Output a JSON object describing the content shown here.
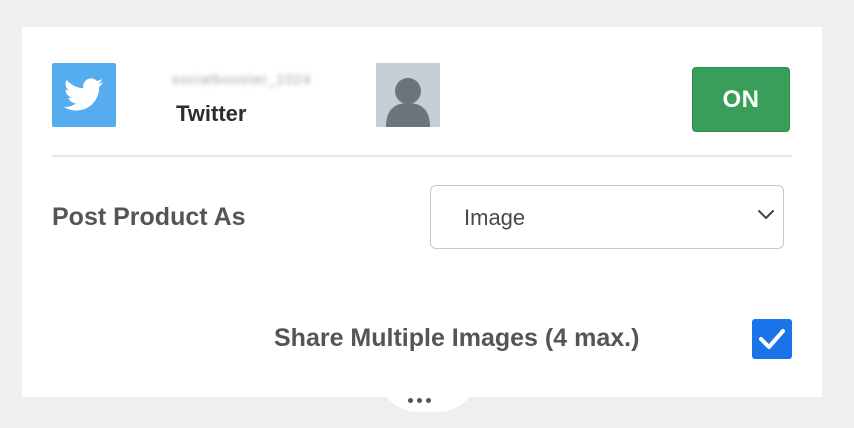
{
  "account": {
    "handle": "socialbooster_1024",
    "network": "Twitter",
    "toggle_label": "ON"
  },
  "post_product": {
    "label": "Post Product As",
    "selected": "Image"
  },
  "share_multiple": {
    "label": "Share Multiple Images (4 max.)",
    "checked": true
  },
  "colors": {
    "twitter_blue": "#55acee",
    "on_green": "#3a9e5b",
    "checkbox_blue": "#1a73e8"
  },
  "icons": {
    "network_icon": "twitter-bird-icon",
    "avatar": "default-user-avatar",
    "dropdown": "chevron-down-icon",
    "checkbox": "check-icon",
    "more": "ellipsis-icon"
  }
}
